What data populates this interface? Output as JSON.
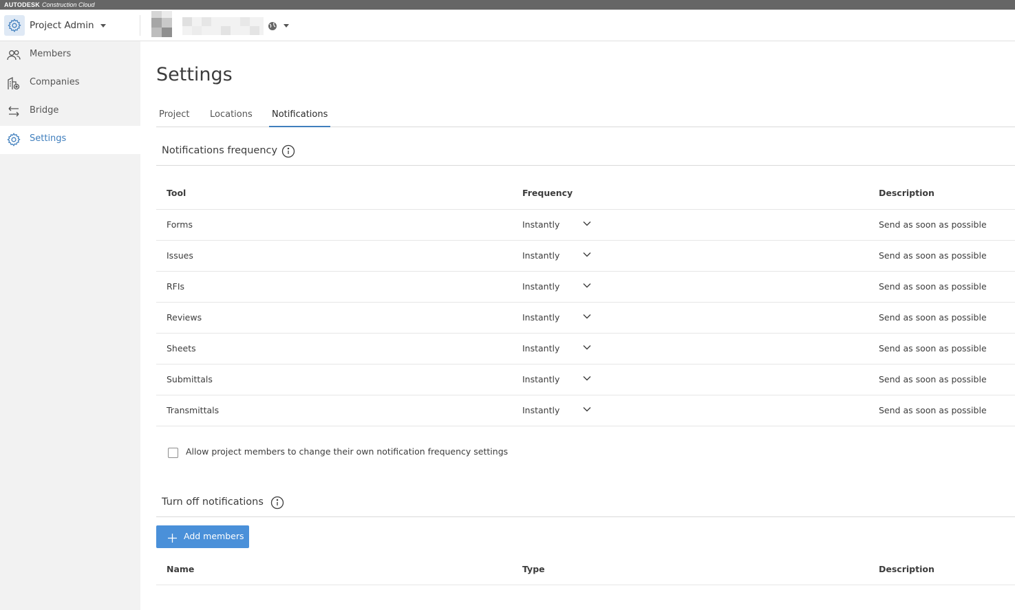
{
  "topbar": {
    "brand": "AUTODESK",
    "product": "Construction Cloud"
  },
  "header": {
    "module_name": "Project Admin"
  },
  "sidebar": {
    "items": [
      {
        "label": "Members",
        "icon": "members-icon"
      },
      {
        "label": "Companies",
        "icon": "companies-icon"
      },
      {
        "label": "Bridge",
        "icon": "bridge-icon"
      },
      {
        "label": "Settings",
        "icon": "gear-icon",
        "active": true
      }
    ]
  },
  "page": {
    "title": "Settings",
    "tabs": [
      {
        "label": "Project"
      },
      {
        "label": "Locations"
      },
      {
        "label": "Notifications",
        "active": true
      }
    ]
  },
  "notifications_frequency": {
    "title": "Notifications frequency",
    "columns": {
      "tool": "Tool",
      "frequency": "Frequency",
      "description": "Description"
    },
    "rows": [
      {
        "tool": "Forms",
        "frequency": "Instantly",
        "description": "Send as soon as possible"
      },
      {
        "tool": "Issues",
        "frequency": "Instantly",
        "description": "Send as soon as possible"
      },
      {
        "tool": "RFIs",
        "frequency": "Instantly",
        "description": "Send as soon as possible"
      },
      {
        "tool": "Reviews",
        "frequency": "Instantly",
        "description": "Send as soon as possible"
      },
      {
        "tool": "Sheets",
        "frequency": "Instantly",
        "description": "Send as soon as possible"
      },
      {
        "tool": "Submittals",
        "frequency": "Instantly",
        "description": "Send as soon as possible"
      },
      {
        "tool": "Transmittals",
        "frequency": "Instantly",
        "description": "Send as soon as possible"
      }
    ],
    "allow_members_label": "Allow project members to change their own notification frequency settings",
    "allow_members_checked": false
  },
  "turn_off": {
    "title": "Turn off notifications",
    "add_button_label": "Add members",
    "columns": {
      "name": "Name",
      "type": "Type",
      "description": "Description"
    }
  },
  "colors": {
    "accent": "#3f7ebd",
    "button": "#4a90d9",
    "sidebar_bg": "#f2f2f2",
    "topbar_bg": "#666666"
  }
}
